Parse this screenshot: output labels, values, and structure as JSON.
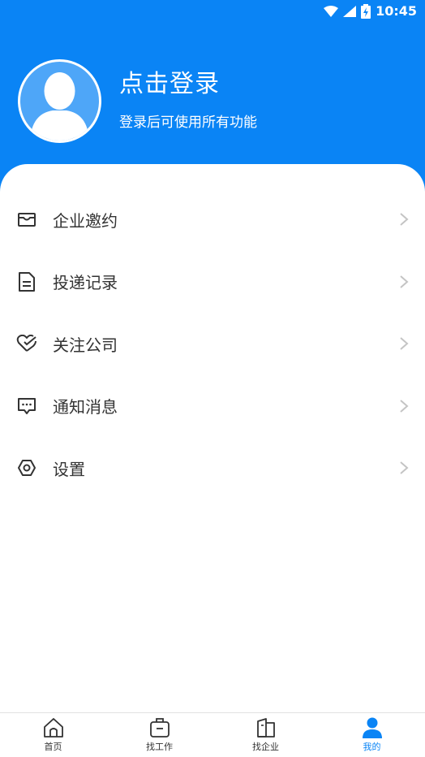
{
  "status_bar": {
    "time": "10:45",
    "icons": [
      "wifi-icon",
      "cellular-signal-icon",
      "battery-charging-icon"
    ]
  },
  "profile": {
    "title": "点击登录",
    "subtitle": "登录后可使用所有功能"
  },
  "menu": [
    {
      "label": "企业邀约",
      "icon": "envelope-icon"
    },
    {
      "label": "投递记录",
      "icon": "document-icon"
    },
    {
      "label": "关注公司",
      "icon": "heart-check-icon"
    },
    {
      "label": "通知消息",
      "icon": "chat-bubble-icon"
    },
    {
      "label": "设置",
      "icon": "settings-icon"
    }
  ],
  "tabbar": [
    {
      "label": "首页",
      "icon": "home-icon"
    },
    {
      "label": "找工作",
      "icon": "briefcase-icon"
    },
    {
      "label": "找企业",
      "icon": "building-icon"
    },
    {
      "label": "我的",
      "icon": "user-icon",
      "active": true
    }
  ],
  "colors": {
    "primary": "#0a84f5",
    "text": "#333333",
    "arrow": "#c4c4c4"
  }
}
